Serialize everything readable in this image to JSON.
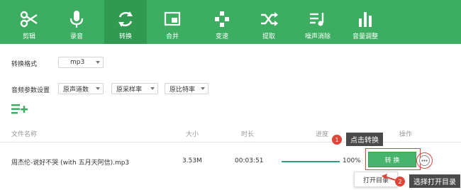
{
  "toolbar": {
    "items": [
      {
        "label": "剪辑",
        "icon": "scissors-icon"
      },
      {
        "label": "录音",
        "icon": "microphone-icon"
      },
      {
        "label": "转换",
        "icon": "refresh-icon"
      },
      {
        "label": "合并",
        "icon": "merge-icon"
      },
      {
        "label": "变速",
        "icon": "speed-icon"
      },
      {
        "label": "提取",
        "icon": "shuffle-icon"
      },
      {
        "label": "噪声消除",
        "icon": "noise-icon"
      },
      {
        "label": "音量调整",
        "icon": "volume-bars-icon"
      }
    ],
    "active": "转换",
    "bg_color": "#3dae61"
  },
  "options": {
    "format_label": "转换格式",
    "format_value": "mp3",
    "audio_params_label": "音频参数设置",
    "channels_value": "原声道数",
    "samplerate_value": "原采样率",
    "bitrate_value": "原比特率",
    "add_icon": "add-list-icon"
  },
  "table": {
    "headers": {
      "name": "文件名称",
      "size": "大小",
      "duration": "时长",
      "progress": "进度",
      "action": "操作"
    },
    "rows": [
      {
        "name": "周杰伦-说好不哭 (with 五月天阿信).mp3",
        "size": "3.53M",
        "duration": "00:03:51",
        "progress": "100%",
        "progress_value": 1.0,
        "button": "转 换"
      }
    ]
  },
  "annotations": {
    "step1_number": "1",
    "step1_text": "点击转换",
    "step2_number": "2",
    "step2_text": "选择打开目录"
  },
  "context_menu": {
    "item": "打开目录"
  }
}
